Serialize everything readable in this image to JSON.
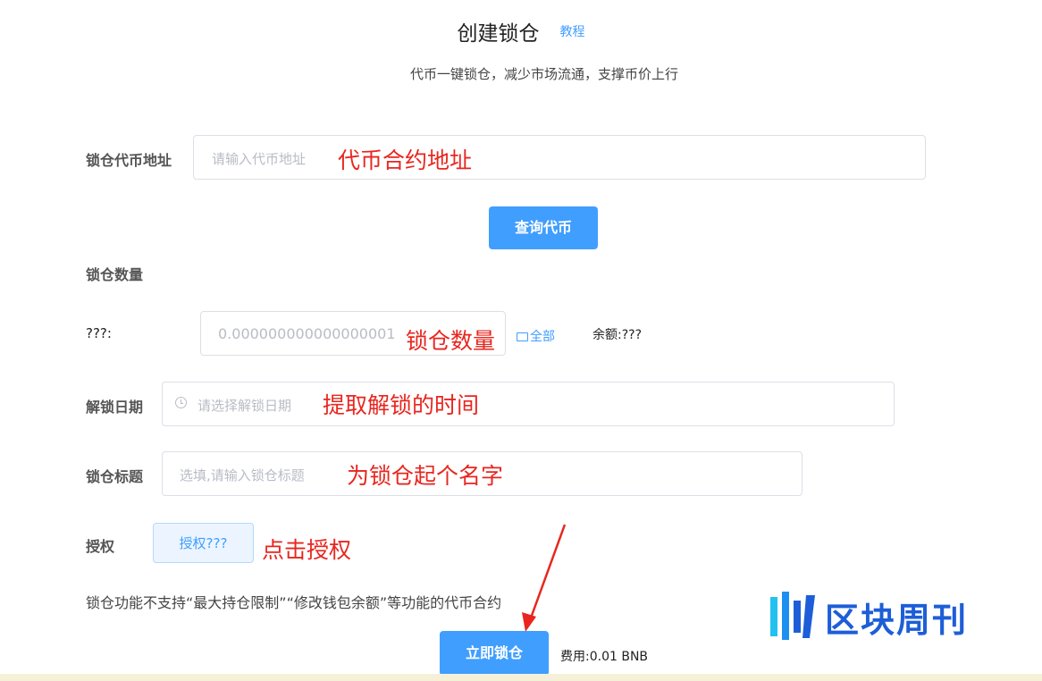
{
  "header": {
    "title": "创建锁仓",
    "tutorial_link": "教程",
    "subtitle": "代币一键锁仓，减少市场流通，支撑币价上行"
  },
  "token_address": {
    "label": "锁仓代币地址",
    "placeholder": "请输入代币地址",
    "annotation": "代币合约地址"
  },
  "query_button": {
    "label": "查询代币"
  },
  "lock_amount": {
    "section_label": "锁仓数量",
    "token_label": "???:",
    "placeholder": "0.000000000000000001",
    "annotation": "锁仓数量",
    "all_link": "全部",
    "balance": "余额:???"
  },
  "unlock_date": {
    "label": "解锁日期",
    "placeholder": "请选择解锁日期",
    "annotation": "提取解锁的时间"
  },
  "lock_title": {
    "label": "锁仓标题",
    "placeholder": "选填,请输入锁仓标题",
    "annotation": "为锁仓起个名字"
  },
  "authorize": {
    "label": "授权",
    "button": "授权???",
    "annotation": "点击授权"
  },
  "notice": "锁仓功能不支持“最大持仓限制”“修改钱包余额”等功能的代币合约",
  "submit": {
    "button": "立即锁仓",
    "fee": "费用:0.01 BNB"
  },
  "watermark": {
    "text": "区块周刊"
  },
  "colors": {
    "primary": "#409eff",
    "annotation": "#e8261f",
    "watermark": "#1d5ed8"
  }
}
